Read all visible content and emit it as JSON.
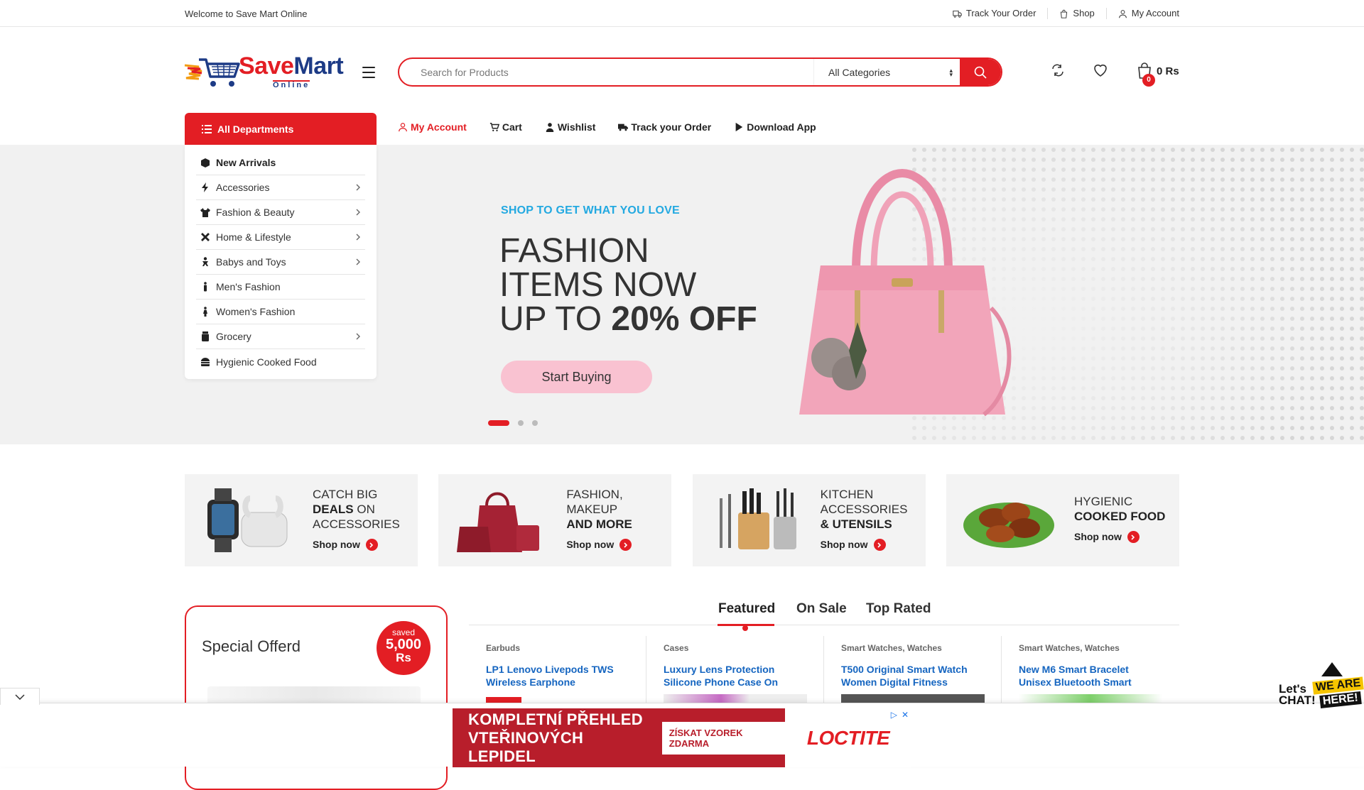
{
  "topbar": {
    "welcome": "Welcome to Save Mart Online",
    "links": [
      {
        "label": "Track Your Order",
        "icon": "truck-icon"
      },
      {
        "label": "Shop",
        "icon": "shopping-bag-icon"
      },
      {
        "label": "My Account",
        "icon": "user-icon"
      }
    ]
  },
  "logo": {
    "save": "Save",
    "mart": "Mart",
    "sub": "Online"
  },
  "search": {
    "placeholder": "Search for Products",
    "category": "All Categories"
  },
  "header": {
    "cart_count": "0",
    "cart_total": "0 Rs"
  },
  "departments": {
    "title": "All Departments",
    "items": [
      {
        "label": "New Arrivals",
        "icon": "box-icon",
        "has_sub": false
      },
      {
        "label": "Accessories",
        "icon": "bolt-icon",
        "has_sub": true
      },
      {
        "label": "Fashion & Beauty",
        "icon": "tshirt-icon",
        "has_sub": true
      },
      {
        "label": "Home & Lifestyle",
        "icon": "tools-icon",
        "has_sub": true
      },
      {
        "label": "Babys and Toys",
        "icon": "baby-icon",
        "has_sub": true
      },
      {
        "label": "Men's Fashion",
        "icon": "male-icon",
        "has_sub": false
      },
      {
        "label": "Women's Fashion",
        "icon": "female-icon",
        "has_sub": false
      },
      {
        "label": "Grocery",
        "icon": "jar-icon",
        "has_sub": true
      },
      {
        "label": "Hygienic Cooked Food",
        "icon": "burger-icon",
        "has_sub": false
      }
    ]
  },
  "nav": [
    {
      "label": "My Account",
      "icon": "user-icon"
    },
    {
      "label": "Cart",
      "icon": "cart-icon"
    },
    {
      "label": "Wishlist",
      "icon": "user-tie-icon"
    },
    {
      "label": "Track your Order",
      "icon": "truck-icon"
    },
    {
      "label": "Download App",
      "icon": "play-icon"
    }
  ],
  "hero": {
    "tagline": "SHOP TO GET WHAT YOU LOVE",
    "line1": "FASHION",
    "line2": "ITEMS NOW",
    "line3a": "UP TO ",
    "line3b": "20% OFF",
    "button": "Start Buying",
    "slides": 3,
    "active_slide": 1
  },
  "banners": [
    {
      "l1": "CATCH BIG",
      "l2b": "DEALS",
      "l2": " ON",
      "l3": "ACCESSORIES",
      "shop": "Shop now"
    },
    {
      "l1": "FASHION,",
      "l2": "MAKEUP",
      "l3b": "AND MORE",
      "shop": "Shop now"
    },
    {
      "l1": "KITCHEN",
      "l2": "ACCESSORIES",
      "l3b": "& UTENSILS",
      "shop": "Shop now"
    },
    {
      "l1": "HYGIENIC",
      "l2b": "COOKED FOOD",
      "shop": "Shop now"
    }
  ],
  "special": {
    "title": "Special Offerd",
    "saved_label": "saved",
    "saved_amount": "5,000",
    "saved_unit": "Rs"
  },
  "tabs": [
    "Featured",
    "On Sale",
    "Top Rated"
  ],
  "products": [
    {
      "cat": "Earbuds",
      "name1": "LP1 Lenovo Livepods TWS",
      "name2": "Wireless Earphone"
    },
    {
      "cat": "Cases",
      "name1": "Luxury Lens Protection",
      "name2": "Silicone Phone Case On"
    },
    {
      "cat": "Smart Watches, Watches",
      "name1": "T500 Original Smart Watch",
      "name2": "Women Digital Fitness"
    },
    {
      "cat": "Smart Watches, Watches",
      "name1": "New M6 Smart Bracelet",
      "name2": "Unisex Bluetooth Smart"
    }
  ],
  "ad": {
    "headline1": "KOMPLETNÍ PŘEHLED",
    "headline2": "VTEŘINOVÝCH LEPIDEL",
    "cta": "ZÍSKAT VZOREK ZDARMA",
    "brand": "LOCTITE"
  },
  "chat": {
    "t1a": "Let's",
    "t1b": "CHAT!",
    "t2": "WE ARE",
    "t3": "HERE!"
  },
  "colors": {
    "accent": "#e31e24",
    "tagline": "#23a9e1",
    "link": "#1565c0"
  }
}
